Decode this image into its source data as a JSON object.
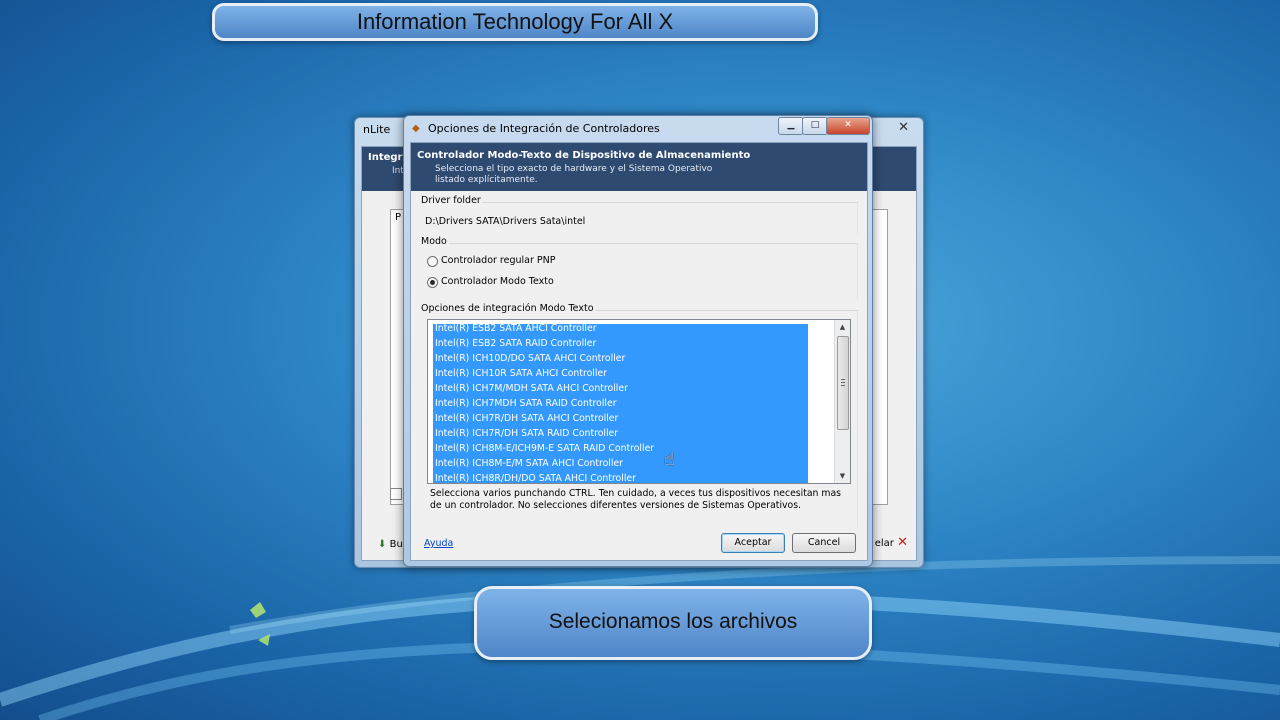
{
  "top_banner": {
    "text": "Information Technology For All X"
  },
  "bottom_banner": {
    "text": "Selecionamos los archivos"
  },
  "back_window": {
    "title": "nLite",
    "header_title": "Integra",
    "header_sub": "Int",
    "panel_label": "P",
    "left_button": "Bu",
    "right_button": "elar"
  },
  "dialog": {
    "title": "Opciones de Integración de Controladores",
    "header": {
      "title": "Controlador Modo-Texto de Dispositivo de Almacenamiento",
      "description": "Selecciona el tipo exacto de hardware y el Sistema Operativo listado explícitamente."
    },
    "driver_folder": {
      "label": "Driver folder",
      "path": "D:\\Drivers SATA\\Drivers Sata\\intel"
    },
    "mode": {
      "label": "Modo",
      "options": [
        {
          "label": "Controlador regular PNP",
          "selected": false
        },
        {
          "label": "Controlador Modo Texto",
          "selected": true
        }
      ]
    },
    "integration": {
      "label": "Opciones de integración Modo Texto",
      "items": [
        "Intel(R) ESB2 SATA AHCI Controller",
        "Intel(R) ESB2 SATA RAID Controller",
        "Intel(R) ICH10D/DO SATA AHCI Controller",
        "Intel(R) ICH10R SATA AHCI Controller",
        "Intel(R) ICH7M/MDH SATA AHCI Controller",
        "Intel(R) ICH7MDH SATA RAID Controller",
        "Intel(R) ICH7R/DH SATA AHCI Controller",
        "Intel(R) ICH7R/DH SATA RAID Controller",
        "Intel(R) ICH8M-E/ICH9M-E SATA RAID Controller",
        "Intel(R) ICH8M-E/M SATA AHCI Controller",
        "Intel(R) ICH8R/DH/DO SATA AHCI Controller"
      ]
    },
    "hint": "Selecciona varios punchando CTRL. Ten cuidado, a veces tus dispositivos necesitan mas de un controlador. No selecciones diferentes versiones de Sistemas Operativos.",
    "help_link": "Ayuda",
    "ok_button": "Aceptar",
    "cancel_button": "Cancel"
  }
}
